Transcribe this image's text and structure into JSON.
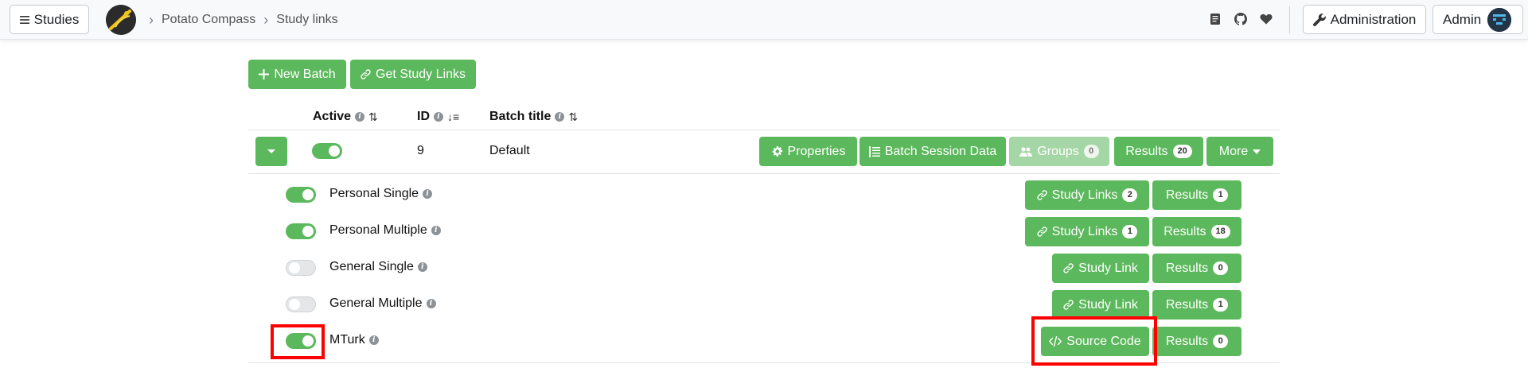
{
  "navbar": {
    "studies_label": "Studies",
    "breadcrumbs": [
      "Potato Compass",
      "Study links"
    ],
    "admin_label": "Administration",
    "user_label": "Admin"
  },
  "toolbar": {
    "new_batch_label": "New Batch",
    "get_study_links_label": "Get Study Links"
  },
  "table": {
    "headers": {
      "active": "Active",
      "id": "ID",
      "batch_title": "Batch title"
    },
    "batch": {
      "active": true,
      "id": "9",
      "title": "Default",
      "properties_label": "Properties",
      "session_data_label": "Batch Session Data",
      "groups_label": "Groups",
      "groups_count": "0",
      "results_label": "Results",
      "results_count": "20",
      "more_label": "More"
    },
    "types": [
      {
        "name": "Personal Single",
        "active": true,
        "link_label": "Study Links",
        "link_count": "2",
        "results_label": "Results",
        "results_count": "1"
      },
      {
        "name": "Personal Multiple",
        "active": true,
        "link_label": "Study Links",
        "link_count": "1",
        "results_label": "Results",
        "results_count": "18"
      },
      {
        "name": "General Single",
        "active": false,
        "link_label": "Study Link",
        "results_label": "Results",
        "results_count": "0"
      },
      {
        "name": "General Multiple",
        "active": false,
        "link_label": "Study Link",
        "results_label": "Results",
        "results_count": "1"
      },
      {
        "name": "MTurk",
        "active": true,
        "link_label": "Source Code",
        "results_label": "Results",
        "results_count": "0"
      }
    ]
  },
  "colors": {
    "primary": "#5cb85c",
    "highlight": "#ff0000",
    "navbar_bg": "#f8f9fa"
  }
}
